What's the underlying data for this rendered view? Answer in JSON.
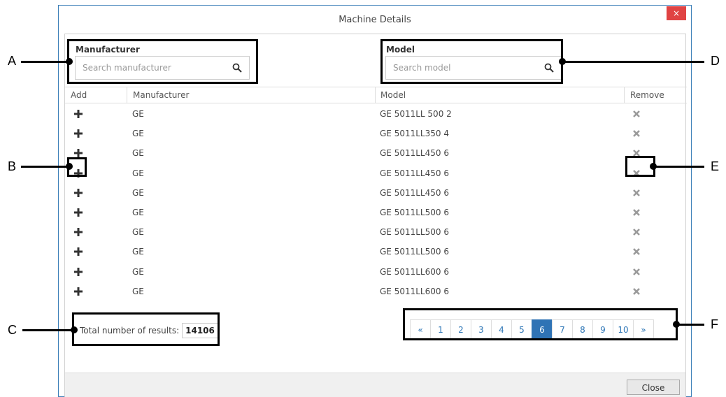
{
  "window": {
    "title": "Machine Details",
    "close_glyph": "×"
  },
  "manufacturer_search": {
    "label": "Manufacturer",
    "placeholder": "Search manufacturer"
  },
  "model_search": {
    "label": "Model",
    "placeholder": "Search model"
  },
  "table": {
    "headers": {
      "add": "Add",
      "manufacturer": "Manufacturer",
      "model": "Model",
      "remove": "Remove"
    },
    "rows": [
      {
        "manufacturer": "GE",
        "model": "GE 5011LL 500 2"
      },
      {
        "manufacturer": "GE",
        "model": "GE 5011LL350 4"
      },
      {
        "manufacturer": "GE",
        "model": "GE 5011LL450 6"
      },
      {
        "manufacturer": "GE",
        "model": "GE 5011LL450 6"
      },
      {
        "manufacturer": "GE",
        "model": "GE 5011LL450 6"
      },
      {
        "manufacturer": "GE",
        "model": "GE 5011LL500 6"
      },
      {
        "manufacturer": "GE",
        "model": "GE 5011LL500 6"
      },
      {
        "manufacturer": "GE",
        "model": "GE 5011LL500 6"
      },
      {
        "manufacturer": "GE",
        "model": "GE 5011LL600 6"
      },
      {
        "manufacturer": "GE",
        "model": "GE 5011LL600 6"
      }
    ]
  },
  "results": {
    "label": "Total number of results:",
    "total": "14106"
  },
  "pagination": {
    "prev": "«",
    "pages": [
      "1",
      "2",
      "3",
      "4",
      "5",
      "6",
      "7",
      "8",
      "9",
      "10"
    ],
    "current": "6",
    "next": "»"
  },
  "footer": {
    "close_label": "Close"
  },
  "callouts": {
    "a": "A",
    "b": "B",
    "c": "C",
    "d": "D",
    "e": "E",
    "f": "F"
  },
  "colors": {
    "accent": "#2f73b5",
    "close_red": "#e04343"
  }
}
